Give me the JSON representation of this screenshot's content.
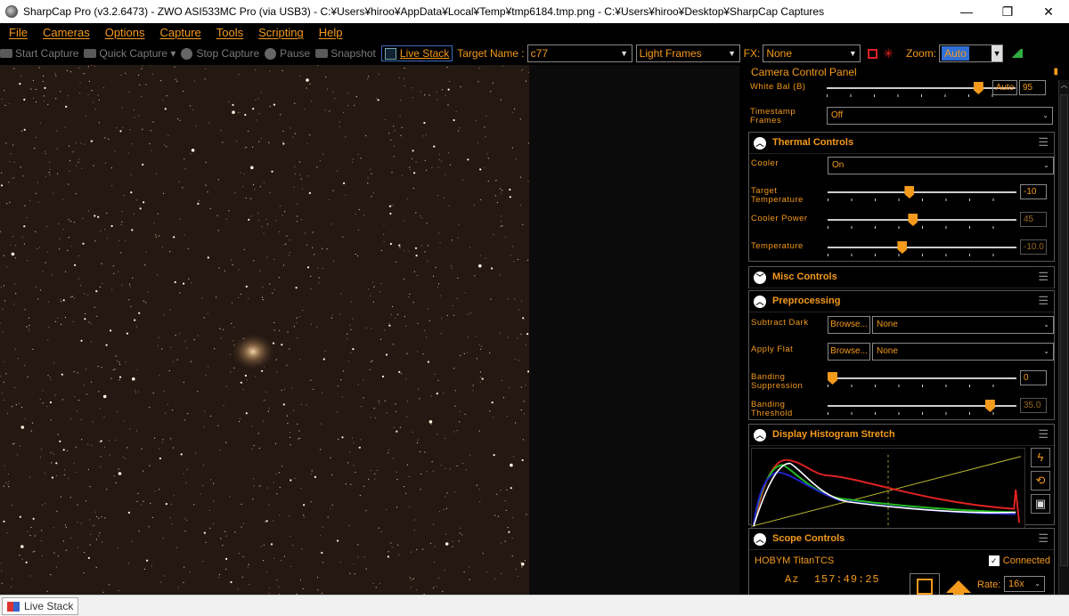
{
  "window": {
    "title": "SharpCap Pro (v3.2.6473) - ZWO ASI533MC Pro (via USB3) - C:¥Users¥hiroo¥AppData¥Local¥Temp¥tmp6184.tmp.png - C:¥Users¥hiroo¥Desktop¥SharpCap Captures",
    "controls": {
      "minimize": "—",
      "maximize": "❐",
      "close": "✕"
    }
  },
  "menu": [
    "File",
    "Cameras",
    "Options",
    "Capture",
    "Tools",
    "Scripting",
    "Help"
  ],
  "toolbar": {
    "start_capture": "Start Capture",
    "quick_capture": "Quick Capture",
    "stop_capture": "Stop Capture",
    "pause": "Pause",
    "snapshot": "Snapshot",
    "live_stack": "Live Stack",
    "target_name_label": "Target Name :",
    "target_name_value": "c77",
    "frame_type": "Light Frames",
    "fx_label": "FX:",
    "fx_value": "None",
    "zoom_label": "Zoom:",
    "zoom_value": "Auto"
  },
  "panel": {
    "title": "Camera Control Panel",
    "pin_icon": "pin-icon",
    "white_bal": {
      "label": "White Bal (B)",
      "auto": "Auto",
      "value": "95",
      "level": 0.82
    },
    "timestamp": {
      "label": "Timestamp Frames",
      "value": "Off"
    },
    "thermal": {
      "title": "Thermal Controls",
      "cooler_label": "Cooler",
      "cooler_value": "On",
      "target_temp_label": "Target Temperature",
      "target_temp_value": "-10",
      "target_temp_level": 0.43,
      "cooler_power_label": "Cooler Power",
      "cooler_power_value": "45",
      "cooler_power_level": 0.45,
      "temperature_label": "Temperature",
      "temperature_value": "-10.0",
      "temperature_level": 0.39
    },
    "misc": {
      "title": "Misc Controls"
    },
    "preprocessing": {
      "title": "Preprocessing",
      "subtract_dark_label": "Subtract Dark",
      "browse": "Browse...",
      "subtract_dark_value": "None",
      "apply_flat_label": "Apply Flat",
      "apply_flat_value": "None",
      "banding_supp_label": "Banding Suppression",
      "banding_supp_value": "0",
      "banding_supp_level": 0.0,
      "banding_thresh_label": "Banding Threshold",
      "banding_thresh_value": "35.0",
      "banding_thresh_level": 0.88
    },
    "histogram": {
      "title": "Display Histogram Stretch"
    },
    "scope": {
      "title": "Scope Controls",
      "mount": "HOBYM TitanTCS",
      "connected": "Connected",
      "az_label": "Az",
      "az_value": "157:49:25",
      "rate_label": "Rate:",
      "rate_value": "16x"
    }
  },
  "status": {
    "tab": "Live Stack"
  },
  "colors": {
    "accent": "#f59a1b",
    "highlight": "#2f6fd6",
    "bg": "#000000"
  }
}
